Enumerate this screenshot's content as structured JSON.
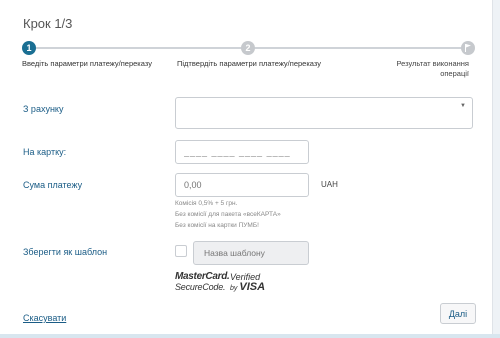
{
  "header": {
    "step_title": "Крок 1/3"
  },
  "progress": {
    "steps": [
      {
        "number": "1",
        "label": "Введіть параметри платежу/переказу",
        "state": "active"
      },
      {
        "number": "2",
        "label": "Підтвердіть параметри платежу/переказу",
        "state": "pending"
      },
      {
        "number": "",
        "label": "Результат виконання операції",
        "state": "pending",
        "icon": "flag-icon"
      }
    ],
    "active_color": "#1a6f93",
    "pending_color": "#c6c9cd"
  },
  "form": {
    "from_account": {
      "label": "З рахунку",
      "value": ""
    },
    "card": {
      "label": "На картку:",
      "placeholder": "____ ____ ____ ____"
    },
    "amount": {
      "label": "Сума платежу",
      "placeholder": "0,00",
      "currency": "UAH",
      "notes": [
        "Комісія 0,5% + 5 грн.",
        "Без комісії для пакета «всеКАРТА»",
        "Без комісії на картки ПУМБ!"
      ]
    },
    "save_template": {
      "label": "Зберегти як шаблон",
      "placeholder": "Назва шаблону",
      "checked": false
    }
  },
  "security_badges": {
    "mastercard": {
      "line1": "MasterCard.",
      "line2": "SecureCode."
    },
    "visa": {
      "line1": "Verified",
      "line2_prefix": "by",
      "line2_brand": "VISA"
    }
  },
  "footer": {
    "cancel_label": "Скасувати",
    "next_label": "Далі"
  },
  "colors": {
    "link": "#1a5c86",
    "border": "#c9cdd2"
  }
}
